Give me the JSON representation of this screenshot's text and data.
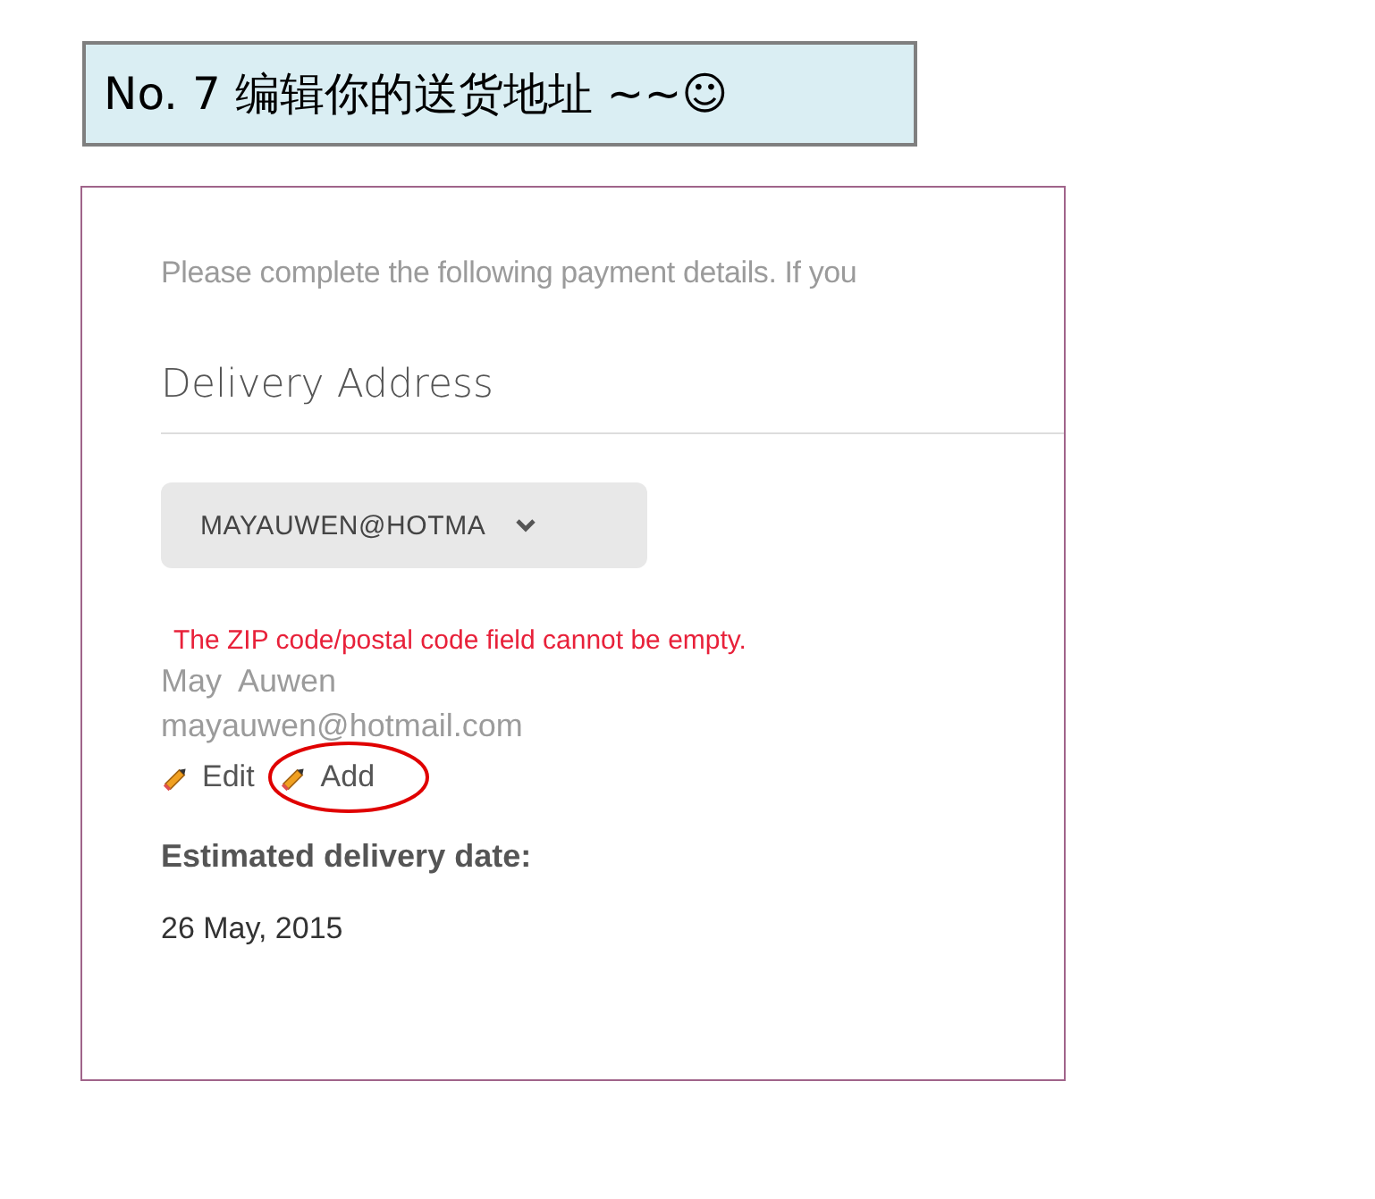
{
  "slide_title": "No. 7 编辑你的送货地址  ~~☺",
  "panel": {
    "intro": "Please complete the following payment details. If you",
    "heading": "Delivery Address",
    "address_select": "MAYAUWEN@HOTMA",
    "error": "The ZIP code/postal code field cannot be empty.",
    "name": "May  Auwen",
    "email": "mayauwen@hotmail.com",
    "actions": [
      {
        "label": "Edit",
        "highlighted": false
      },
      {
        "label": "Add",
        "highlighted": true
      }
    ],
    "delivery_label": "Estimated delivery date:",
    "delivery_date": "26 May, 2015"
  }
}
